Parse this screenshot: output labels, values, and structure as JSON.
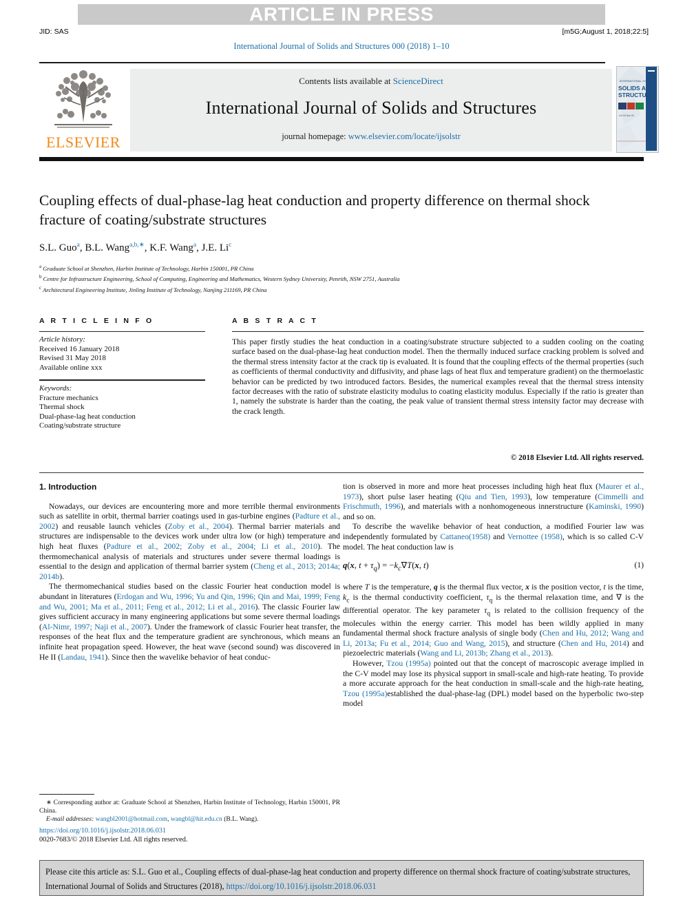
{
  "banner": {
    "text": "ARTICLE IN PRESS",
    "jid": "JID: SAS",
    "version_stamp": "[m5G;August 1, 2018;22:5]",
    "running_head": "International Journal of Solids and Structures 000 (2018) 1–10",
    "band_color": "#c9c9c9",
    "link_color": "#1a6fa8"
  },
  "masthead": {
    "contents_prefix": "Contents lists available at ",
    "sciencedirect": "ScienceDirect",
    "journal_title": "International Journal of Solids and Structures",
    "homepage_prefix": "journal homepage: ",
    "homepage_url": "www.elsevier.com/locate/ijsolstr",
    "publisher": "ELSEVIER",
    "publisher_color": "#f08a1b",
    "cover_title_line1": "SOLIDS AND",
    "cover_title_line2": "STRUCTURES"
  },
  "article": {
    "title": "Coupling effects of dual-phase-lag heat conduction and property difference on thermal shock fracture of coating/substrate structures",
    "authors_html": "S.L. Guo<sup>a</sup>, B.L. Wang<sup>a,b,∗</sup>, K.F. Wang<sup>a</sup>, J.E. Li<sup>c</sup>",
    "affiliations": [
      {
        "marker": "a",
        "text": "Graduate School at Shenzhen, Harbin Institute of Technology, Harbin 150001, PR China"
      },
      {
        "marker": "b",
        "text": "Centre for Infrastructure Engineering, School of Computing, Engineering and Mathematics, Western Sydney University, Penrith, NSW 2751, Australia"
      },
      {
        "marker": "c",
        "text": "Architectural Engineering Institute, Jinling Institute of Technology, Nanjing 211169, PR China"
      }
    ]
  },
  "article_info": {
    "heading": "A R T I C L E   I N F O",
    "history_label": "Article history:",
    "history": [
      "Received 16 January 2018",
      "Revised 31 May 2018",
      "Available online xxx"
    ],
    "keywords_label": "Keywords:",
    "keywords": [
      "Fracture mechanics",
      "Thermal shock",
      "Dual-phase-lag heat conduction",
      "Coating/substrate structure"
    ]
  },
  "abstract": {
    "heading": "A B S T R A C T",
    "body": "This paper firstly studies the heat conduction in a coating/substrate structure subjected to a sudden cooling on the coating surface based on the dual-phase-lag heat conduction model. Then the thermally induced surface cracking problem is solved and the thermal stress intensity factor at the crack tip is evaluated. It is found that the coupling effects of the thermal properties (such as coefficients of thermal conductivity and diffusivity, and phase lags of heat flux and temperature gradient) on the thermoelastic behavior can be predicted by two introduced factors. Besides, the numerical examples reveal that the thermal stress intensity factor decreases with the ratio of substrate elasticity modulus to coating elasticity modulus. Especially if the ratio is greater than 1, namely the substrate is harder than the coating, the peak value of transient thermal stress intensity factor may decrease with the crack length.",
    "copyright": "© 2018 Elsevier Ltd. All rights reserved."
  },
  "body": {
    "section_heading": "1. Introduction",
    "left_paragraphs": [
      "Nowadays, our devices are encountering more and more terrible thermal environments such as satellite in orbit, thermal barrier coatings used in gas-turbine engines (Padture et al., 2002) and reusable launch vehicles (Zoby et al., 2004). Thermal barrier materials and structures are indispensable to the devices work under ultra low (or high) temperature and high heat fluxes (Padture et al., 2002; Zoby et al., 2004; Li et al., 2010). The thermomechanical analysis of materials and structures under severe thermal loadings is essential to the design and application of thermal barrier system (Cheng et al., 2013; 2014a; 2014b).",
      "The thermomechanical studies based on the classic Fourier heat conduction model is abundant in literatures (Erdogan and Wu, 1996; Yu and Qin, 1996; Qin and Mai, 1999; Feng and Wu, 2001; Ma et al., 2011; Feng et al., 2012; Li et al., 2016). The classic Fourier law gives sufficient accuracy in many engineering applications but some severe thermal loadings (Al-Nimr, 1997; Naji et al., 2007). Under the framework of classic Fourier heat transfer, the responses of the heat flux and the temperature gradient are synchronous, which means an infinite heat propagation speed. However, the heat wave (second sound) was discovered in He II (Landau, 1941). Since then the wavelike behavior of heat conduc-"
    ],
    "right_paragraphs": [
      "tion is observed in more and more heat processes including high heat flux (Maurer et al., 1973), short pulse laser heating (Qiu and Tien, 1993), low temperature (Cimmelli and Frischmuth, 1996), and materials with a nonhomogeneous innerstructure (Kaminski, 1990) and so on.",
      "To describe the wavelike behavior of heat conduction, a modified Fourier law was independently formulated by Cattaneo(1958) and Vernottee (1958), which is so called C-V model. The heat conduction law is",
      "where T is the temperature, q is the thermal flux vector, x is the position vector, t is the time, kc is the thermal conductivity coefficient, τq is the thermal relaxation time, and ∇ is the differential operator. The key parameter τq is related to the collision frequency of the molecules within the energy carrier. This model has been wildly applied in many fundamental thermal shock fracture analysis of single body (Chen and Hu, 2012; Wang and Li, 2013a; Fu et al., 2014; Guo and Wang, 2015), and structure (Chen and Hu, 2014) and piezoelectric materials (Wang and Li, 2013b; Zhang et al., 2013).",
      "However, Tzou (1995a) pointed out that the concept of macroscopic average implied in the C-V model may lose its physical support in small-scale and high-rate heating. To provide a more accurate approach for the heat conduction in small-scale and the high-rate heating, Tzou (1995a)established the dual-phase-lag (DPL) model based on the hyperbolic two-step model"
    ],
    "equation_1": "q(x, t + τq) = −kc∇T(x, t)",
    "equation_1_number": "(1)"
  },
  "footnote": {
    "corresponding_label": "∗ Corresponding author at: Graduate School at Shenzhen, Harbin Institute of Technology, Harbin 150001, PR China.",
    "email_label": "E-mail addresses:",
    "email_1": "wangbl2001@hotmail.com",
    "email_2": "wangbl@hit.edu.cn",
    "email_owner": "(B.L. Wang).",
    "doi_url": "https://doi.org/10.1016/j.ijsolstr.2018.06.031",
    "issn_line": "0020-7683/© 2018 Elsevier Ltd. All rights reserved."
  },
  "cite_box": {
    "text_before_link": "Please cite this article as: S.L. Guo et al., Coupling effects of dual-phase-lag heat conduction and property difference on thermal shock fracture of coating/substrate structures, International Journal of Solids and Structures (2018), ",
    "link": "https://doi.org/10.1016/j.ijsolstr.2018.06.031",
    "background": "#d4d4d4"
  }
}
